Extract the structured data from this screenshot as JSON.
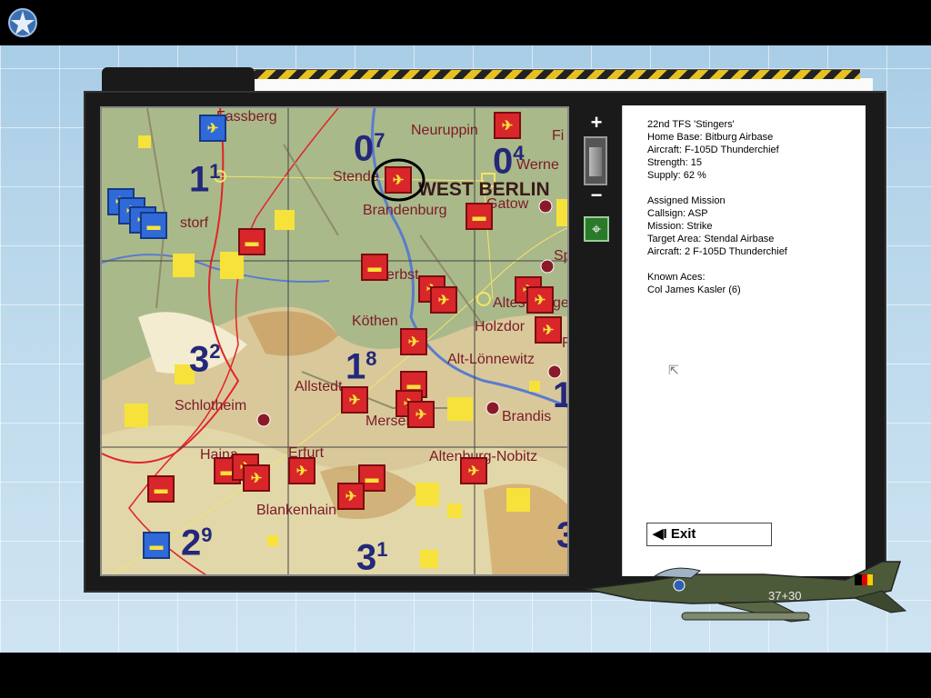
{
  "top": {
    "logo_icon": "star-emblem-icon"
  },
  "map": {
    "labels": {
      "fassberg": "Fassberg",
      "neuruppin": "Neuruppin",
      "werne": "Werne",
      "stendal": "Stende",
      "west_berlin": "WEST BERLIN",
      "gatow": "Gatow",
      "brandenburg": "Brandenburg",
      "zerbst": "erbst",
      "altes": "Altes",
      "holzdorf": "Holzdor",
      "kothen": "Köthen",
      "alt_lonnewitz": "Alt-Lönnewitz",
      "allstedt": "Allstedt",
      "schlotheim": "Schlotheim",
      "merseburg": "Mersebu",
      "brandis": "Brandis",
      "haina": "Haina",
      "erfurt": "Erfurt",
      "altenburg": "Altenburg-Nobitz",
      "blankenhain": "Blankenhain",
      "fi": "Fi",
      "sp": "Sp",
      "f": "F",
      "ge": "ge",
      "storf": "storf"
    },
    "zones": [
      {
        "main": "0",
        "sub": "7"
      },
      {
        "main": "0",
        "sub": "4"
      },
      {
        "main": "1",
        "sub": "1"
      },
      {
        "main": "3",
        "sub": "2"
      },
      {
        "main": "1",
        "sub": "8"
      },
      {
        "main": "2",
        "sub": "9"
      },
      {
        "main": "3",
        "sub": "1"
      },
      {
        "main": "1",
        "sub": ""
      },
      {
        "main": "3",
        "sub": ""
      }
    ],
    "selected_unit_icon": "aircraft-icon",
    "colors": {
      "nato": "#2f6ad8",
      "warsaw": "#d9262b",
      "water": "#5a7ccf",
      "border": "#e0242a"
    }
  },
  "zoom": {
    "plus": "+",
    "minus": "−",
    "target_icon": "crosshair-icon"
  },
  "info": {
    "unit_name": "22nd TFS 'Stingers'",
    "home_base": "Home Base: Bitburg Airbase",
    "aircraft": "Aircraft: F-105D Thunderchief",
    "strength": "Strength: 15",
    "supply": "Supply: 62 %",
    "assigned_header": "Assigned Mission",
    "callsign": "Callsign: ASP",
    "mission": "Mission: Strike",
    "target_area": "Target Area: Stendal Airbase",
    "mission_aircraft": "Aircraft: 2 F-105D Thunderchief",
    "aces_header": "Known Aces:",
    "ace": "Col James Kasler (6)",
    "exit_label": "◀I Exit"
  },
  "jet": {
    "tail_code": "37+30"
  }
}
